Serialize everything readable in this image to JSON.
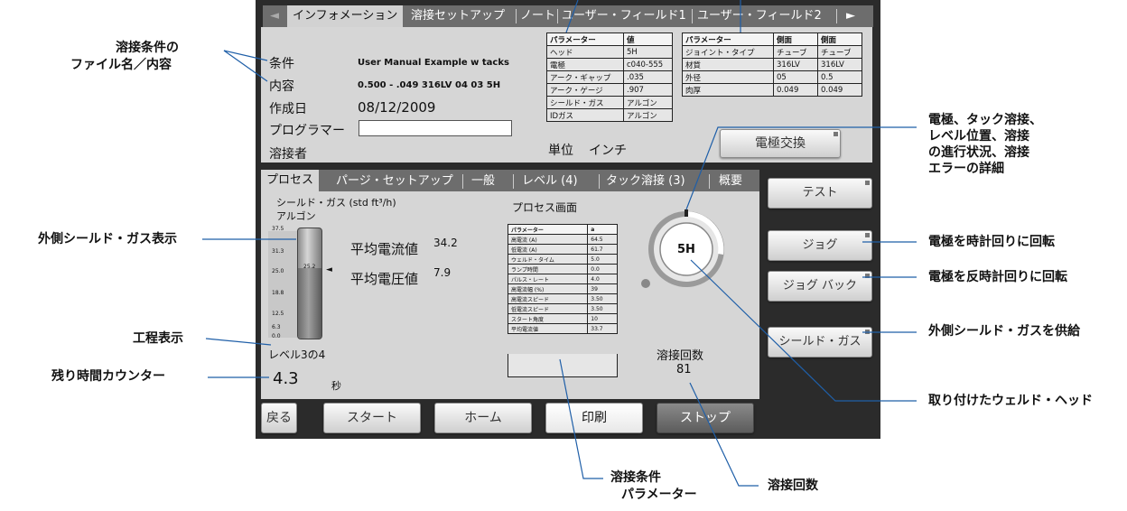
{
  "top_tabs": {
    "items": [
      "インフォメーション",
      "溶接セットアップ",
      "ノート",
      "ユーザー・フィールド1",
      "ユーザー・フィールド2"
    ],
    "scroll_right": "►",
    "scroll_left": "◄"
  },
  "info": {
    "condition_label": "条件",
    "condition_value": "User Manual Example w tacks",
    "content_label": "内容",
    "content_value": "0.500 - .049 316LV 04 03 5H",
    "created_label": "作成日",
    "created_value": "08/12/2009",
    "programmer_label": "プログラマー",
    "welder_label": "溶接者",
    "unit_label": "単位",
    "unit_value": "インチ",
    "electrode_button": "電極交換"
  },
  "param_table": {
    "headers": [
      "パラメーター",
      "値"
    ],
    "rows": [
      [
        "ヘッド",
        "5H"
      ],
      [
        "電極",
        "c040-555"
      ],
      [
        "アーク・ギャップ",
        ".035"
      ],
      [
        "アーク・ゲージ",
        ".907"
      ],
      [
        "シールド・ガス",
        "アルゴン"
      ],
      [
        "IDガス",
        "アルゴン"
      ]
    ]
  },
  "side_table": {
    "headers": [
      "パラメーター",
      "側面",
      "側面"
    ],
    "rows": [
      [
        "ジョイント・タイプ",
        "チューブ",
        "チューブ"
      ],
      [
        "材質",
        "316LV",
        "316LV"
      ],
      [
        "外径",
        "05",
        "0.5"
      ],
      [
        "肉厚",
        "0.049",
        "0.049"
      ]
    ]
  },
  "process_tabs": {
    "items": [
      "プロセス",
      "パージ・セットアップ",
      "一般",
      "レベル (4)",
      "タック溶接 (3)",
      "概要"
    ]
  },
  "process": {
    "gas_label": "シールド・ガス (std ft³/h)",
    "gas_type": "アルゴン",
    "gauge_ticks": [
      "37.5",
      "31.3",
      "25.0",
      "18.8",
      "12.5",
      "6.3",
      "0.0"
    ],
    "gauge_value": "25.2",
    "avg_current_label": "平均電流値",
    "avg_current_value": "34.2",
    "avg_voltage_label": "平均電圧値",
    "avg_voltage_value": "7.9",
    "level_text": "レベル3の4",
    "time_value": "4.3",
    "time_unit": "秒",
    "screen_title": "プロセス画面",
    "head_label": "5H",
    "weld_count_label": "溶接回数",
    "weld_count_value": "81"
  },
  "process_table": {
    "headers": [
      "パラメーター",
      "a"
    ],
    "rows": [
      [
        "高電流 (A)",
        "64.5"
      ],
      [
        "低電流 (A)",
        "61.7"
      ],
      [
        "ウェルド・タイム",
        "5.0"
      ],
      [
        "ランプ時間",
        "0.0"
      ],
      [
        "パルス・レート",
        "4.0"
      ],
      [
        "高電流幅 (%)",
        "39"
      ],
      [
        "高電流スピード",
        "3.50"
      ],
      [
        "低電流スピード",
        "3.50"
      ],
      [
        "スタート角度",
        "10"
      ],
      [
        "平均電流値",
        "33.7"
      ]
    ]
  },
  "side_buttons": [
    "テスト",
    "ジョグ",
    "ジョグ バック",
    "シールド・ガス"
  ],
  "bottom_buttons": [
    "戻る",
    "スタート",
    "ホーム",
    "印刷",
    "ストップ"
  ],
  "annotations": {
    "file": [
      "溶接条件の",
      "ファイル名／内容"
    ],
    "outer_gas_display": "外側シールド・ガス表示",
    "process_display": "工程表示",
    "remaining_timer": "残り時間カウンター",
    "electrode_detail": [
      "電極、タック溶接、",
      "レベル位置、溶接",
      "の進行状況、溶接",
      "エラーの詳細"
    ],
    "rotate_cw": "電極を時計回りに回転",
    "rotate_ccw": "電極を反時計回りに回転",
    "supply_gas": "外側シールド・ガスを供給",
    "weld_head": "取り付けたウェルド・ヘッド",
    "weld_params": [
      "溶接条件",
      "パラメーター"
    ],
    "weld_count": "溶接回数"
  },
  "colors": {
    "panel": "#d6d6d6",
    "bezel": "#2b2b2b",
    "tabbar": "#6d6d6d",
    "stop_button": "#6a6a6a"
  }
}
